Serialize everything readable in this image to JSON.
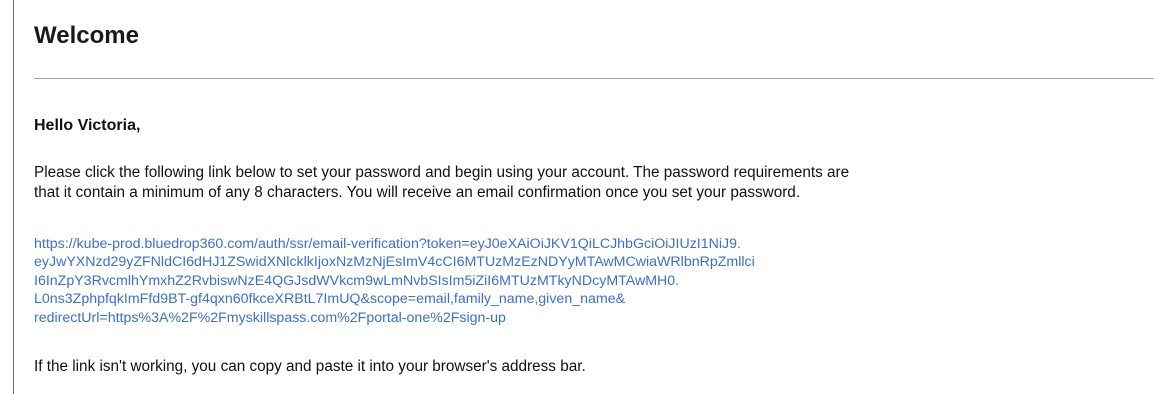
{
  "email": {
    "title": "Welcome",
    "greeting": "Hello Victoria,",
    "body_lines": [
      "Please click the following link below to set your password and begin using your account. The password requirements are",
      "that it contain a minimum of any 8 characters. You will receive an email confirmation once you set your password."
    ],
    "link_lines": [
      "https://kube-prod.bluedrop360.com/auth/ssr/email-verification?token=eyJ0eXAiOiJKV1QiLCJhbGciOiJIUzI1NiJ9.",
      "eyJwYXNzd29yZFNldCI6dHJ1ZSwidXNlcklkIjoxNzMzNjEsImV4cCI6MTUzMzEzNDYyMTAwMCwiaWRlbnRpZmllci",
      "I6InZpY3RvcmlhYmxhZ2RvbiswNzE4QGJsdWVkcm9wLmNvbSIsIm5iZiI6MTUzMTkyNDcyMTAwMH0.",
      "L0ns3ZphpfqkImFfd9BT-gf4qxn60fkceXRBtL7ImUQ&scope=email,family_name,given_name&",
      "redirectUrl=https%3A%2F%2Fmyskillspass.com%2Fportal-one%2Fsign-up"
    ],
    "footer": "If the link isn't working, you can copy and paste it into your browser's address bar.",
    "colors": {
      "link": "#3b6fd0",
      "text": "#111111",
      "rule": "#a0a0a0",
      "border": "#6f6f6f"
    }
  }
}
